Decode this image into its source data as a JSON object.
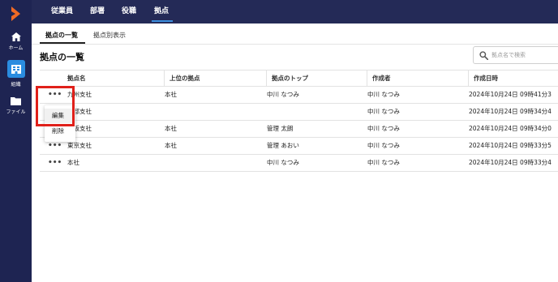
{
  "sidebar": {
    "logo_icon": "brand-chevron-icon",
    "items": [
      {
        "label": "ホーム",
        "icon": "home-icon"
      },
      {
        "label": "組織",
        "icon": "organization-icon",
        "active": true
      },
      {
        "label": "ファイル",
        "icon": "folder-icon"
      }
    ]
  },
  "header": {
    "tabs": [
      {
        "label": "従業員"
      },
      {
        "label": "部署"
      },
      {
        "label": "役職"
      },
      {
        "label": "拠点",
        "active": true
      }
    ]
  },
  "subtabs": [
    {
      "label": "拠点の一覧",
      "active": true
    },
    {
      "label": "拠点別表示"
    }
  ],
  "page": {
    "title": "拠点の一覧"
  },
  "search": {
    "placeholder": "拠点名で検索",
    "value": ""
  },
  "table": {
    "columns": [
      "拠点名",
      "上位の拠点",
      "拠点のトップ",
      "作成者",
      "作成日時"
    ],
    "rows": [
      {
        "name": "九州支社",
        "parent": "本社",
        "top": "中川 なつみ",
        "creator": "中川 なつみ",
        "created": "2024年10月24日 09時41分3"
      },
      {
        "name": "北部支社",
        "parent": "",
        "top": "",
        "creator": "中川 なつみ",
        "created": "2024年10月24日 09時34分4"
      },
      {
        "name": "大阪支社",
        "parent": "本社",
        "top": "管理 太朗",
        "creator": "中川 なつみ",
        "created": "2024年10月24日 09時34分0"
      },
      {
        "name": "東京支社",
        "parent": "本社",
        "top": "管理 あおい",
        "creator": "中川 なつみ",
        "created": "2024年10月24日 09時33分5"
      },
      {
        "name": "本社",
        "parent": "",
        "top": "中川 なつみ",
        "creator": "中川 なつみ",
        "created": "2024年10月24日 09時33分4"
      }
    ],
    "row_menu_glyph": "•••"
  },
  "context_menu": {
    "items": [
      {
        "label": "編集"
      },
      {
        "label": "削除"
      }
    ]
  },
  "colors": {
    "sidebar": "#1e2452",
    "header": "#242a57",
    "accent": "#2a8ce0",
    "highlight": "#e0201a"
  }
}
